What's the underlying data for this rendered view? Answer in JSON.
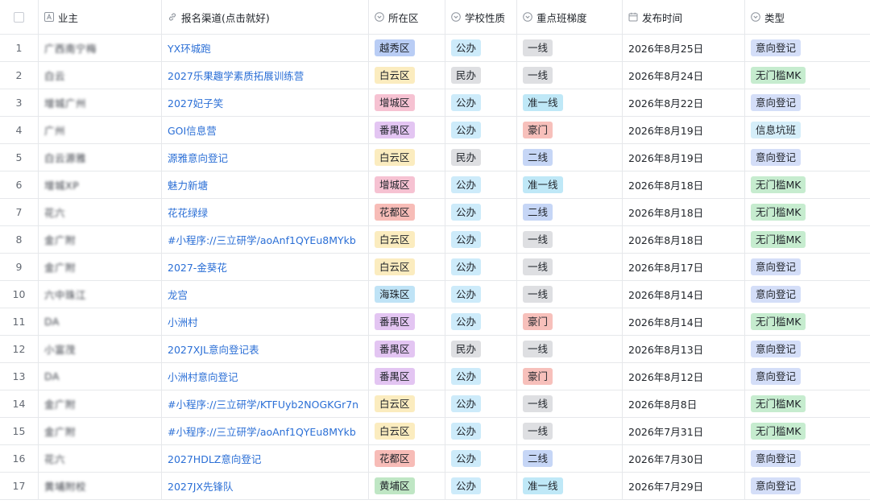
{
  "header": {
    "owner": "业主",
    "channel": "报名渠道(点击就好)",
    "district": "所在区",
    "nature": "学校性质",
    "tier": "重点班梯度",
    "date": "发布时间",
    "type": "类型"
  },
  "header_icons": {
    "owner": "text-field-icon",
    "channel": "link-icon",
    "district": "single-select-icon",
    "nature": "single-select-icon",
    "tier": "single-select-icon",
    "date": "calendar-icon",
    "type": "single-select-icon"
  },
  "tag_colors": {
    "越秀区": "#b9cdf5",
    "白云区": "#fbecbf",
    "增城区": "#f6c2d2",
    "番禺区": "#e3c5f2",
    "花都区": "#f7bcb7",
    "海珠区": "#bfe3f6",
    "黄埔区": "#bfe6c4",
    "公办": "#cdebfa",
    "民办": "#dedfe2",
    "一线": "#dedfe2",
    "准一线": "#bfe8f7",
    "豪门": "#f7c0bb",
    "二线": "#c6d6f6",
    "意向登记": "#d4def8",
    "无门槛MK": "#c6eccf",
    "信息坑班": "#d5eef9"
  },
  "link_color": "#2b6fd6",
  "rows": [
    {
      "idx": "1",
      "owner": "广西南宁梅",
      "channel": "YX环城跑",
      "district": "越秀区",
      "nature": "公办",
      "tier": "一线",
      "date": "2026年8月25日",
      "type": "意向登记"
    },
    {
      "idx": "2",
      "owner": "白云",
      "channel": "2027乐果趣学素质拓展训练营",
      "district": "白云区",
      "nature": "民办",
      "tier": "一线",
      "date": "2026年8月24日",
      "type": "无门槛MK"
    },
    {
      "idx": "3",
      "owner": "增城广州",
      "channel": "2027妃子笑",
      "district": "增城区",
      "nature": "公办",
      "tier": "准一线",
      "date": "2026年8月22日",
      "type": "意向登记"
    },
    {
      "idx": "4",
      "owner": "广州",
      "channel": "GOI信息营",
      "district": "番禺区",
      "nature": "公办",
      "tier": "豪门",
      "date": "2026年8月19日",
      "type": "信息坑班"
    },
    {
      "idx": "5",
      "owner": "白云源雅",
      "channel": "源雅意向登记",
      "district": "白云区",
      "nature": "民办",
      "tier": "二线",
      "date": "2026年8月19日",
      "type": "意向登记"
    },
    {
      "idx": "6",
      "owner": "增城XP",
      "channel": "魅力新塘",
      "district": "增城区",
      "nature": "公办",
      "tier": "准一线",
      "date": "2026年8月18日",
      "type": "无门槛MK"
    },
    {
      "idx": "7",
      "owner": "花六",
      "channel": "花花绿绿",
      "district": "花都区",
      "nature": "公办",
      "tier": "二线",
      "date": "2026年8月18日",
      "type": "无门槛MK"
    },
    {
      "idx": "8",
      "owner": "金广附",
      "channel": "#小程序://三立研学/aoAnf1QYEu8MYkb",
      "district": "白云区",
      "nature": "公办",
      "tier": "一线",
      "date": "2026年8月18日",
      "type": "无门槛MK"
    },
    {
      "idx": "9",
      "owner": "金广附",
      "channel": "2027-金葵花",
      "district": "白云区",
      "nature": "公办",
      "tier": "一线",
      "date": "2026年8月17日",
      "type": "意向登记"
    },
    {
      "idx": "10",
      "owner": "六中珠江",
      "channel": "龙宫",
      "district": "海珠区",
      "nature": "公办",
      "tier": "一线",
      "date": "2026年8月14日",
      "type": "意向登记"
    },
    {
      "idx": "11",
      "owner": "DA",
      "channel": "小洲村",
      "district": "番禺区",
      "nature": "公办",
      "tier": "豪门",
      "date": "2026年8月14日",
      "type": "无门槛MK"
    },
    {
      "idx": "12",
      "owner": "小富茂",
      "channel": "2027XJL意向登记表",
      "district": "番禺区",
      "nature": "民办",
      "tier": "一线",
      "date": "2026年8月13日",
      "type": "意向登记"
    },
    {
      "idx": "13",
      "owner": "DA",
      "channel": "小洲村意向登记",
      "district": "番禺区",
      "nature": "公办",
      "tier": "豪门",
      "date": "2026年8月12日",
      "type": "意向登记"
    },
    {
      "idx": "14",
      "owner": "金广附",
      "channel": "#小程序://三立研学/KTFUyb2NOGKGr7n",
      "district": "白云区",
      "nature": "公办",
      "tier": "一线",
      "date": "2026年8月8日",
      "type": "无门槛MK"
    },
    {
      "idx": "15",
      "owner": "金广附",
      "channel": "#小程序://三立研学/aoAnf1QYEu8MYkb",
      "district": "白云区",
      "nature": "公办",
      "tier": "一线",
      "date": "2026年7月31日",
      "type": "无门槛MK"
    },
    {
      "idx": "16",
      "owner": "花六",
      "channel": "2027HDLZ意向登记",
      "district": "花都区",
      "nature": "公办",
      "tier": "二线",
      "date": "2026年7月30日",
      "type": "意向登记"
    },
    {
      "idx": "17",
      "owner": "黄埔附校",
      "channel": "2027JX先锋队",
      "district": "黄埔区",
      "nature": "公办",
      "tier": "准一线",
      "date": "2026年7月29日",
      "type": "意向登记"
    }
  ]
}
